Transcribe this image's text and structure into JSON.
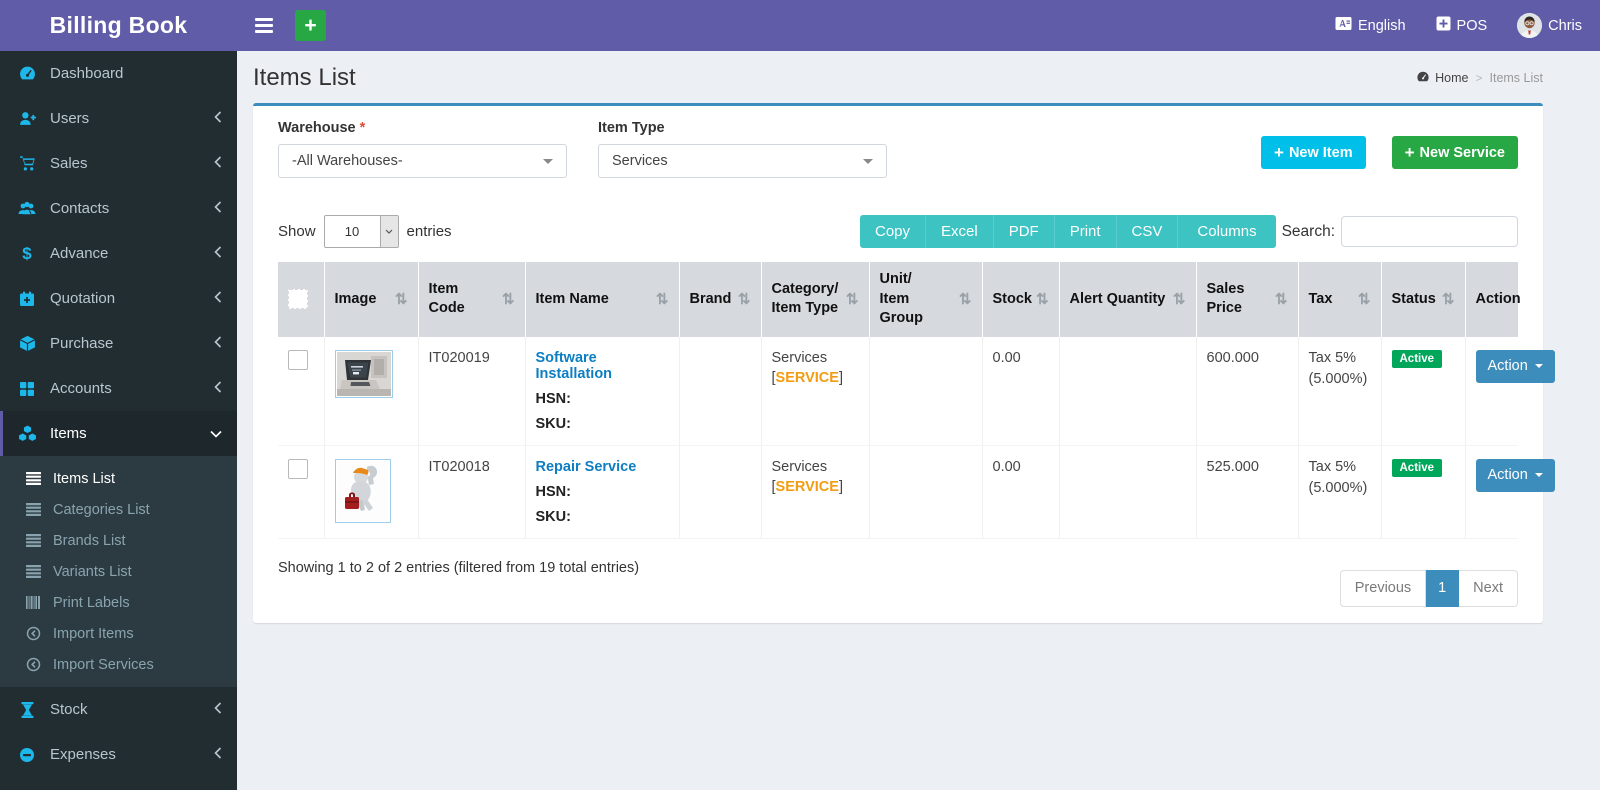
{
  "app": {
    "title": "Billing Book"
  },
  "topbar": {
    "language": "English",
    "pos_label": "POS",
    "username": "Chris"
  },
  "glyphs": {
    "plus": "+",
    "sort": "⇅",
    "breadcrumb_sep": ">"
  },
  "colors": {
    "navbar_purple": "#605ca8",
    "sidebar_dark": "#222d32",
    "submenu_bg": "#2c3b41",
    "box_top_border": "#3c8dbc",
    "export_teal": "#3ec3c3",
    "new_item_aqua": "#00bfe8",
    "new_service_green": "#28a745",
    "active_badge_green": "#00a65a",
    "service_tag_orange": "#f39c12",
    "link_blue": "#0d7ec2",
    "content_bg": "#ecf0f5"
  },
  "sidebar": {
    "items": [
      {
        "label": "Dashboard"
      },
      {
        "label": "Users"
      },
      {
        "label": "Sales"
      },
      {
        "label": "Contacts"
      },
      {
        "label": "Advance"
      },
      {
        "label": "Quotation"
      },
      {
        "label": "Purchase"
      },
      {
        "label": "Accounts"
      },
      {
        "label": "Items"
      },
      {
        "label": "Stock"
      },
      {
        "label": "Expenses"
      }
    ],
    "items_submenu": [
      {
        "label": "Items List"
      },
      {
        "label": "Categories List"
      },
      {
        "label": "Brands List"
      },
      {
        "label": "Variants List"
      },
      {
        "label": "Print Labels"
      },
      {
        "label": "Import Items"
      },
      {
        "label": "Import Services"
      }
    ]
  },
  "page": {
    "title": "Items List"
  },
  "breadcrumb": {
    "home": "Home",
    "current": "Items List"
  },
  "filters": {
    "warehouse_label": "Warehouse",
    "required_mark": "*",
    "warehouse_value": "-All Warehouses-",
    "item_type_label": "Item Type",
    "item_type_value": "Services"
  },
  "actions": {
    "new_item": "New Item",
    "new_service": "New Service"
  },
  "table_controls": {
    "show_label": "Show",
    "page_length": "10",
    "entries_label": "entries",
    "export_buttons": [
      "Copy",
      "Excel",
      "PDF",
      "Print",
      "CSV",
      "Columns"
    ],
    "search_label": "Search:",
    "search_value": ""
  },
  "table": {
    "headers": {
      "image": "Image",
      "item_code": "Item Code",
      "item_name": "Item Name",
      "brand": "Brand",
      "category_line1": "Category/",
      "category_line2": "Item Type",
      "unit_line1": "Unit/",
      "unit_line2": "Item Group",
      "stock": "Stock",
      "alert_quantity": "Alert Quantity",
      "sales_price": "Sales Price",
      "tax": "Tax",
      "status": "Status",
      "action": "Action"
    },
    "labels": {
      "hsn": "HSN:",
      "sku": "SKU:",
      "bracket_open": "[",
      "bracket_close": "]"
    },
    "rows": [
      {
        "item_code": "IT020019",
        "item_name": "Software Installation",
        "brand": "",
        "category": "Services",
        "category_tag": "SERVICE",
        "unit": "",
        "stock": "0.00",
        "alert_quantity": "",
        "sales_price": "600.000",
        "tax_line1": "Tax 5%",
        "tax_line2": "(5.000%)",
        "status": "Active",
        "action_label": "Action"
      },
      {
        "item_code": "IT020018",
        "item_name": "Repair Service",
        "brand": "",
        "category": "Services",
        "category_tag": "SERVICE",
        "unit": "",
        "stock": "0.00",
        "alert_quantity": "",
        "sales_price": "525.000",
        "tax_line1": "Tax 5%",
        "tax_line2": "(5.000%)",
        "status": "Active",
        "action_label": "Action"
      }
    ],
    "summary": "Showing 1 to 2 of 2 entries (filtered from 19 total entries)",
    "pagination": {
      "previous": "Previous",
      "page": "1",
      "next": "Next"
    }
  }
}
